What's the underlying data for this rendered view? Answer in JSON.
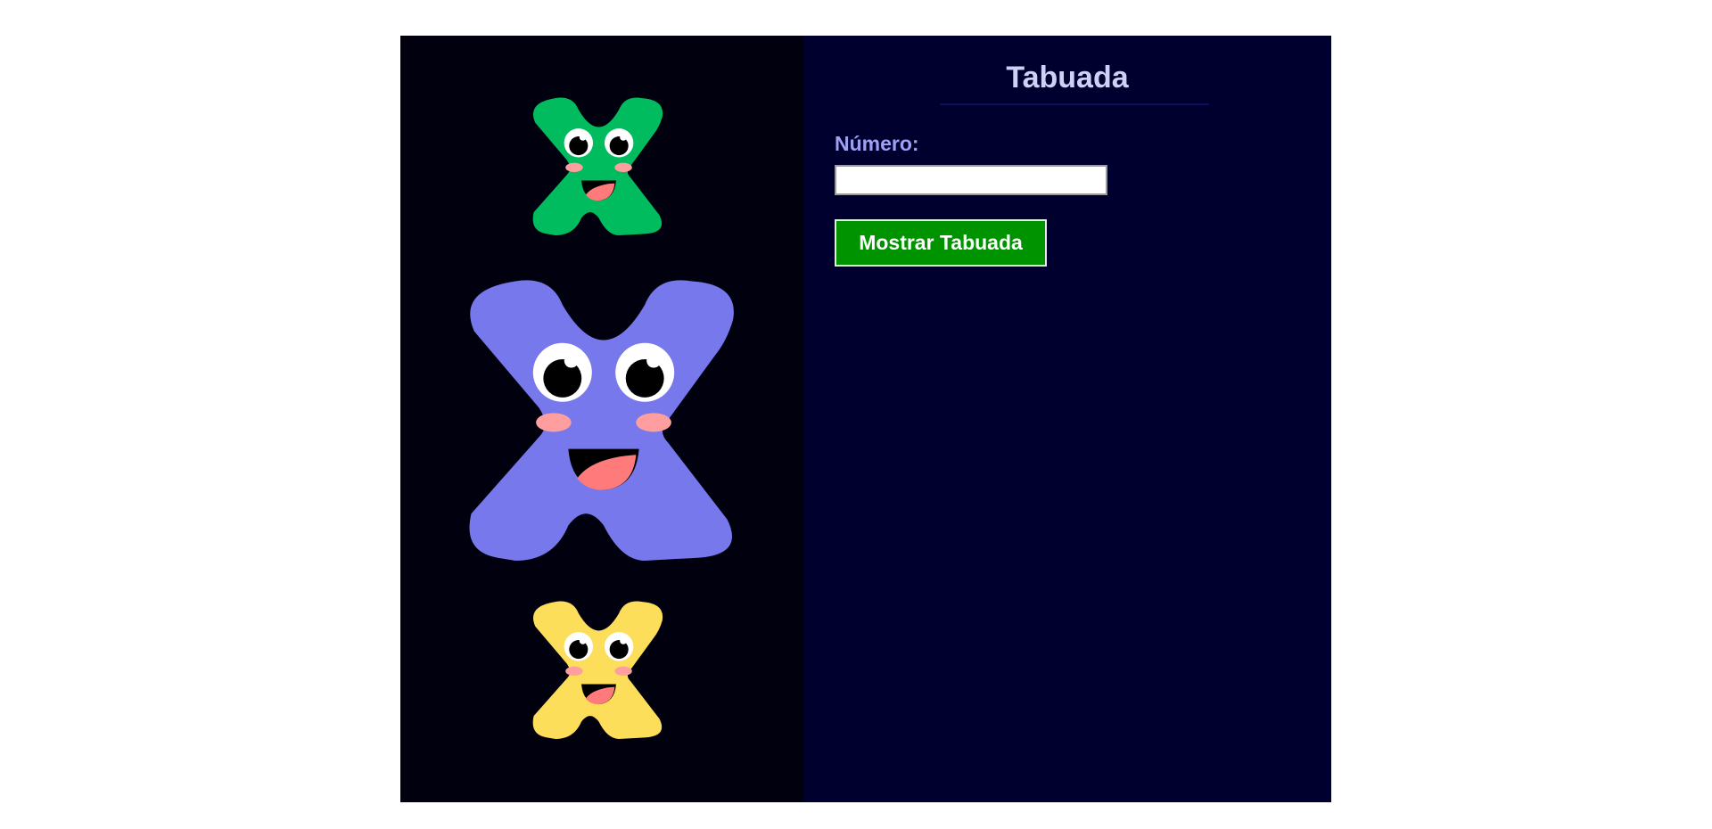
{
  "page": {
    "title": "Tabuada",
    "number_label": "Número:",
    "number_input_value": "",
    "show_button_label": "Mostrar Tabuada"
  },
  "mascots": [
    {
      "name": "green-x-mascot",
      "color": "#00bc5f"
    },
    {
      "name": "purple-x-mascot",
      "color": "#7678ec"
    },
    {
      "name": "yellow-x-mascot",
      "color": "#fdde5b"
    }
  ],
  "colors": {
    "left_panel_bg": "#01000e",
    "right_panel_bg": "#00002f",
    "title": "#cfd0f6",
    "label": "#9ea0f4",
    "button_bg": "#009300",
    "cheek": "#ff9e9e",
    "tongue": "#ff7b7b"
  }
}
